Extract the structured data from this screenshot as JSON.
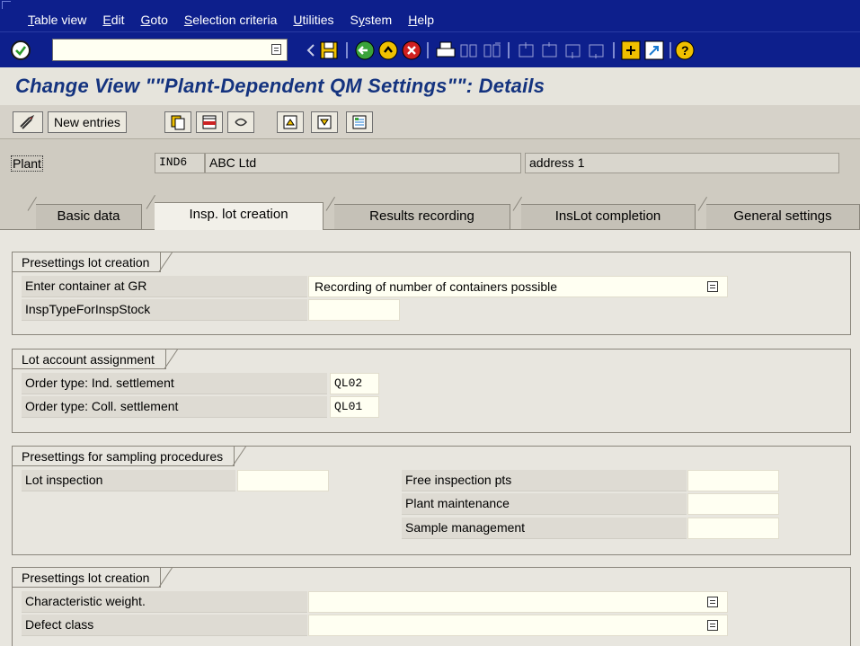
{
  "menu": {
    "items": [
      "Table view",
      "Edit",
      "Goto",
      "Selection criteria",
      "Utilities",
      "System",
      "Help"
    ],
    "underline": [
      "T",
      "E",
      "G",
      "S",
      "U",
      "y",
      "H"
    ]
  },
  "system_toolbar": {
    "command_value": "",
    "icons": [
      "enter-icon",
      "back-nav-icon",
      "save-icon",
      "back-icon",
      "exit-icon",
      "cancel-icon",
      "print-icon",
      "find-icon",
      "find-next-icon",
      "first-page-icon",
      "previous-page-icon",
      "next-page-icon",
      "last-page-icon",
      "create-session-icon",
      "shortcut-icon",
      "help-icon"
    ]
  },
  "title": "Change View \"\"Plant-Dependent QM Settings\"\": Details",
  "app_toolbar": {
    "new_entries": "New entries",
    "icons": [
      "display-change-icon",
      "copy-icon",
      "delete-icon",
      "undo-icon",
      "previous-entry-icon",
      "next-entry-icon",
      "variable-list-icon"
    ]
  },
  "header": {
    "plant_label": "Plant",
    "plant_code": "IND6",
    "plant_name": "ABC Ltd",
    "plant_address": "address 1"
  },
  "tabs": [
    {
      "label": "Basic data",
      "active": false
    },
    {
      "label": "Insp. lot creation",
      "active": true
    },
    {
      "label": "Results recording",
      "active": false
    },
    {
      "label": "InsLot completion",
      "active": false
    },
    {
      "label": "General settings",
      "active": false
    }
  ],
  "groups": {
    "presettings_lot": {
      "title": "Presettings lot creation",
      "enter_container_label": "Enter container at GR",
      "enter_container_value": "Recording of number of containers possible",
      "insp_type_label": "InspTypeForInspStock",
      "insp_type_value": ""
    },
    "lot_account": {
      "title": "Lot account assignment",
      "ind_settlement_label": "Order type: Ind. settlement",
      "ind_settlement_value": "QL02",
      "coll_settlement_label": "Order type: Coll. settlement",
      "coll_settlement_value": "QL01"
    },
    "sampling": {
      "title": "Presettings for sampling procedures",
      "lot_inspection_label": "Lot inspection",
      "lot_inspection_value": "",
      "free_insp_label": "Free inspection pts",
      "free_insp_value": "",
      "plant_maint_label": "Plant maintenance",
      "plant_maint_value": "",
      "sample_mgmt_label": "Sample management",
      "sample_mgmt_value": ""
    },
    "presettings_lot2": {
      "title": "Presettings lot creation",
      "char_weight_label": "Characteristic weight.",
      "char_weight_value": "",
      "defect_class_label": "Defect class",
      "defect_class_value": ""
    }
  }
}
